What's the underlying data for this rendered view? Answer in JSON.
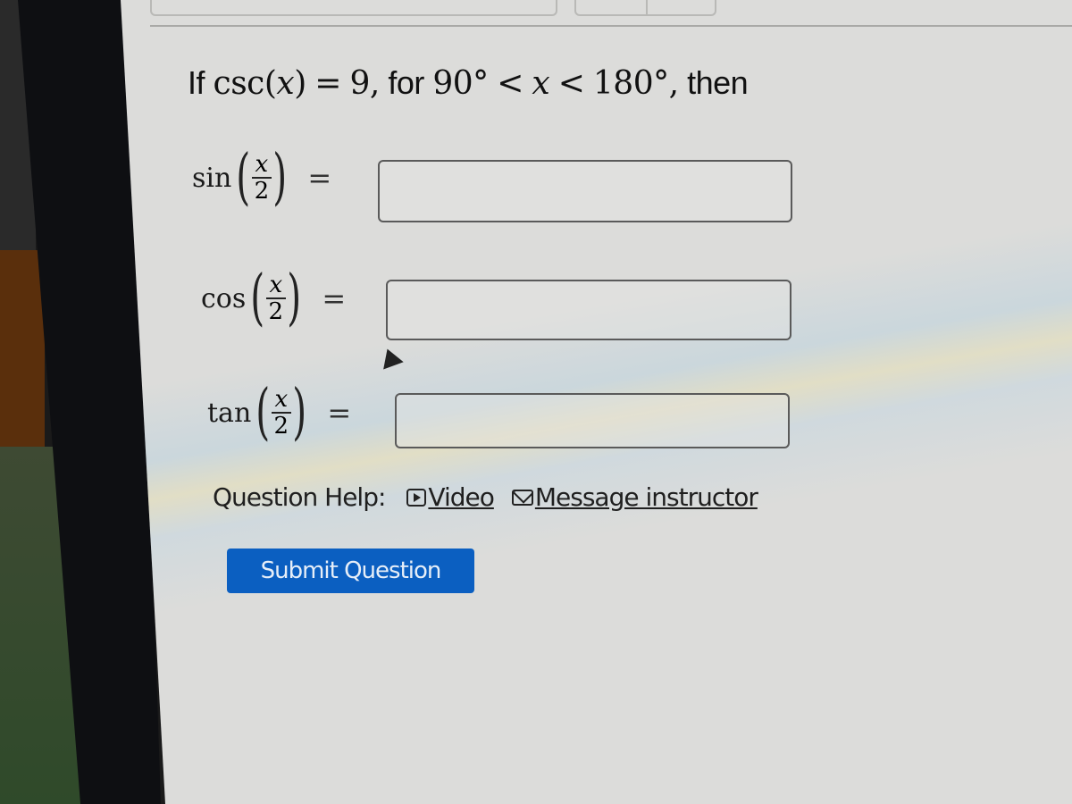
{
  "question": {
    "prefix": "If",
    "func": "csc",
    "var": "x",
    "value": "9",
    "condition_text": "for",
    "lower_bound": "90°",
    "upper_bound": "180°",
    "suffix": "then"
  },
  "rows": [
    {
      "fn": "sin",
      "num": "x",
      "den": "2",
      "eq": "=",
      "answer_value": "",
      "answer_placeholder": ""
    },
    {
      "fn": "cos",
      "num": "x",
      "den": "2",
      "eq": "=",
      "answer_value": "",
      "answer_placeholder": ""
    },
    {
      "fn": "tan",
      "num": "x",
      "den": "2",
      "eq": "=",
      "answer_value": "",
      "answer_placeholder": ""
    }
  ],
  "help": {
    "label": "Question Help:",
    "video_label": "Video",
    "message_label": "Message instructor"
  },
  "submit_label": "Submit Question",
  "colors": {
    "submit_bg": "#0b5fc1"
  }
}
